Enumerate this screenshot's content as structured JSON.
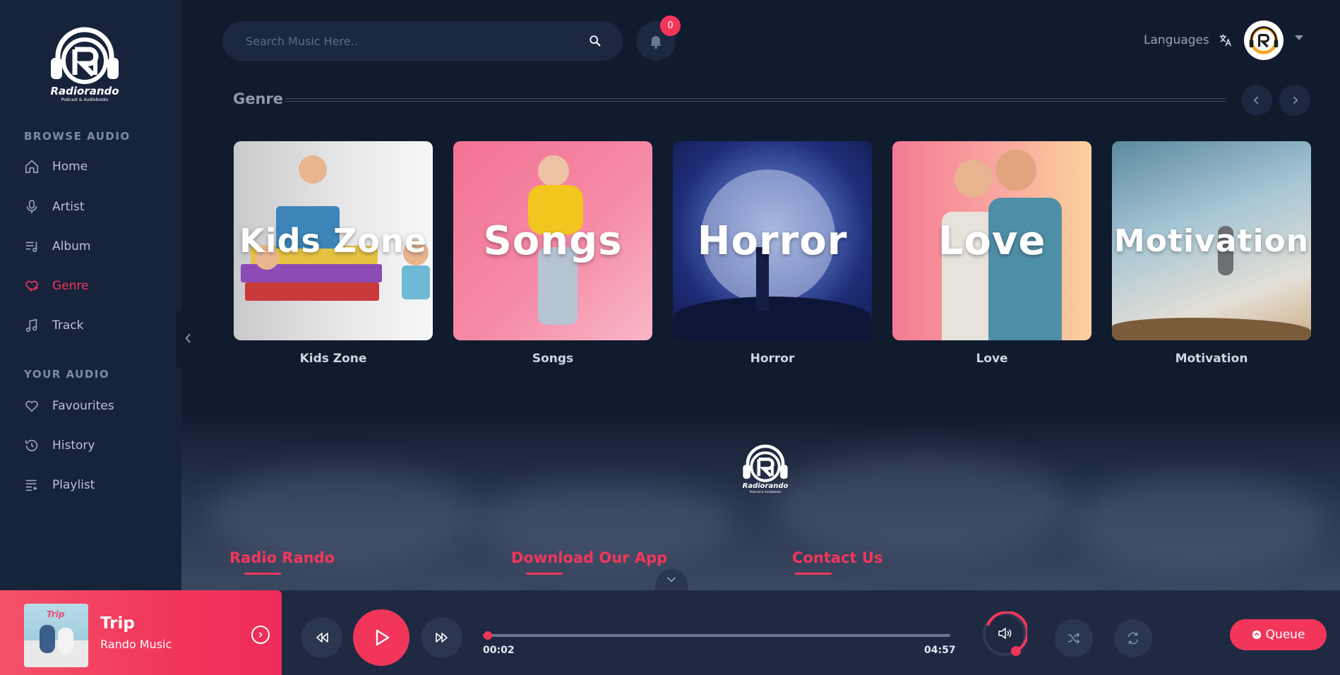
{
  "brand": {
    "name": "Radiorando",
    "tagline": "Podcast & Audiobooks"
  },
  "sidebar": {
    "browse_title": "BROWSE AUDIO",
    "browse_items": [
      {
        "label": "Home",
        "icon": "home-icon"
      },
      {
        "label": "Artist",
        "icon": "microphone-icon"
      },
      {
        "label": "Album",
        "icon": "album-list-icon"
      },
      {
        "label": "Genre",
        "icon": "heart-hand-icon",
        "active": true
      },
      {
        "label": "Track",
        "icon": "music-note-icon"
      }
    ],
    "your_title": "YOUR AUDIO",
    "your_items": [
      {
        "label": "Favourites",
        "icon": "heart-icon"
      },
      {
        "label": "History",
        "icon": "history-icon"
      },
      {
        "label": "Playlist",
        "icon": "playlist-icon"
      }
    ]
  },
  "topbar": {
    "search_placeholder": "Search Music Here..",
    "notification_count": "0",
    "languages_label": "Languages"
  },
  "genre_section": {
    "title": "Genre",
    "cards": [
      {
        "overlay": "Kids Zone",
        "caption": "Kids Zone"
      },
      {
        "overlay": "Songs",
        "caption": "Songs"
      },
      {
        "overlay": "Horror",
        "caption": "Horror"
      },
      {
        "overlay": "Love",
        "caption": "Love"
      },
      {
        "overlay": "Motivation",
        "caption": "Motivation"
      }
    ]
  },
  "footer": {
    "headings": [
      "Radio Rando",
      "Download Our App",
      "Contact Us"
    ]
  },
  "player": {
    "title": "Trip",
    "artist": "Rando Music",
    "cover_text": "Trip",
    "elapsed": "00:02",
    "duration": "04:57",
    "progress_fraction": 0.01,
    "queue_label": "Queue"
  },
  "colors": {
    "accent": "#f2365a",
    "background": "#111b2e",
    "sidebar": "#17233a",
    "surface": "#1c2740"
  }
}
